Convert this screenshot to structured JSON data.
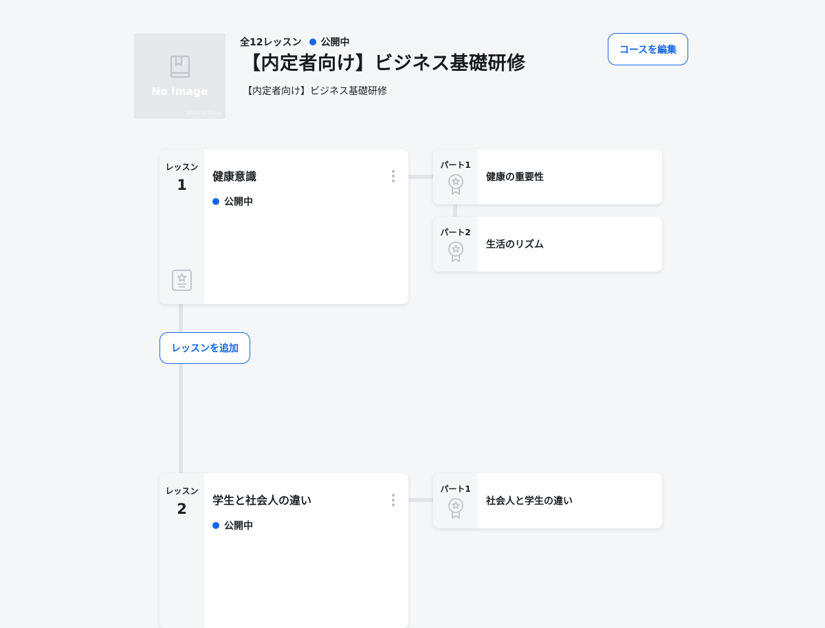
{
  "course": {
    "thumbnail_text": "No Image",
    "thumbnail_brand": "Workschool",
    "lesson_count": "全12レッスン",
    "status": "公開中",
    "title": "【内定者向け】ビジネス基礎研修",
    "description": "【内定者向け】ビジネス基礎研修",
    "edit_button": "コースを編集"
  },
  "add_lesson_button": "レッスンを追加",
  "lessons": [
    {
      "label": "レッスン",
      "number": "1",
      "title": "健康意識",
      "status": "公開中",
      "parts": [
        {
          "label": "パート1",
          "title": "健康の重要性"
        },
        {
          "label": "パート2",
          "title": "生活のリズム"
        }
      ]
    },
    {
      "label": "レッスン",
      "number": "2",
      "title": "学生と社会人の違い",
      "status": "公開中",
      "parts": [
        {
          "label": "パート1",
          "title": "社会人と学生の違い"
        }
      ]
    }
  ],
  "colors": {
    "accent": "#1466e6",
    "background": "#f5f6f8",
    "connector": "#e3e4e8"
  }
}
